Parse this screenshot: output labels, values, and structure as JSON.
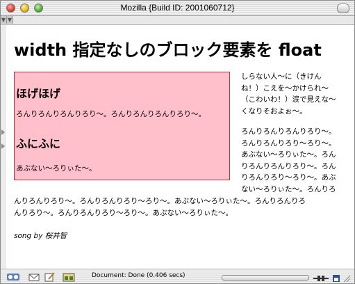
{
  "window": {
    "title": "Mozilla {Build ID: 2001060712}"
  },
  "page": {
    "heading": "width 指定なしのブロック要素を float",
    "float_block": {
      "heading1": "ほげほげ",
      "text1": "ろんりろんりろんりろり〜。ろんりろんりろんりろり〜。",
      "heading2": "ふにふに",
      "text2": "あぶない〜ろりぃた〜。"
    },
    "side_lines": [
      "しらない人〜に（きけん",
      "ね！）こえを〜かけられ〜",
      "（こわいわ！）涙で見えな〜",
      "くなりそおよぉ〜。"
    ],
    "para_lines": [
      "ろんりろんりろんりろり〜。",
      "ろんりろんりろり〜ろり〜。",
      "あぶない〜ろりぃた〜。ろん",
      "りろんりろんりろり〜。ろん",
      "りろんりろり〜ろり〜。あぶ",
      "ない〜ろりぃた〜。ろんりろ"
    ],
    "full_lines": [
      "んりろんりろり〜。ろんりろんりろり〜ろり〜。あぶない〜ろりぃた〜。ろんりろんりろ",
      "んりろり〜。ろんりろんりろり〜ろり〜。あぶない〜ろりぃた〜。"
    ],
    "credit_prefix": "song by",
    "credit_name": "桜井智"
  },
  "statusbar": {
    "status_text": "Document: Done (0.406 secs)"
  },
  "colors": {
    "float_bg": "#ffc0cb",
    "float_border": "#c0303a"
  }
}
